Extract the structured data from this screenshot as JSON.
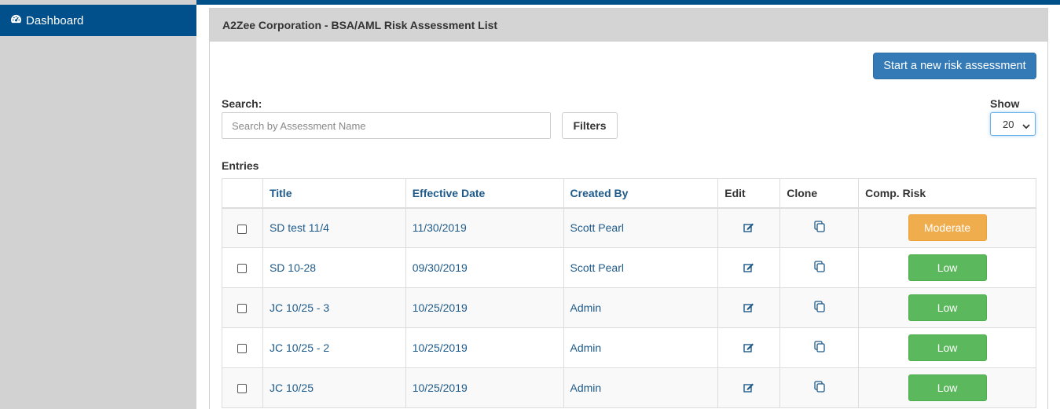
{
  "sidebar": {
    "items": [
      {
        "label": "Dashboard",
        "icon": "dashboard-icon"
      }
    ]
  },
  "panel": {
    "title": "A2Zee Corporation - BSA/AML Risk Assessment List",
    "new_button_label": "Start a new risk assessment"
  },
  "search": {
    "label": "Search:",
    "placeholder": "Search by Assessment Name",
    "value": "",
    "filters_label": "Filters"
  },
  "show": {
    "label": "Show",
    "selected": "20"
  },
  "entries_label": "Entries",
  "table": {
    "columns": [
      "",
      "Title",
      "Effective Date",
      "Created By",
      "Edit",
      "Clone",
      "Comp. Risk"
    ],
    "rows": [
      {
        "title": "SD test 11/4",
        "date": "11/30/2019",
        "created_by": "Scott Pearl",
        "risk": "Moderate",
        "risk_level": "moderate"
      },
      {
        "title": "SD 10-28",
        "date": "09/30/2019",
        "created_by": "Scott Pearl",
        "risk": "Low",
        "risk_level": "low"
      },
      {
        "title": "JC 10/25 - 3",
        "date": "10/25/2019",
        "created_by": "Admin",
        "risk": "Low",
        "risk_level": "low"
      },
      {
        "title": "JC 10/25 - 2",
        "date": "10/25/2019",
        "created_by": "Admin",
        "risk": "Low",
        "risk_level": "low"
      },
      {
        "title": "JC 10/25",
        "date": "10/25/2019",
        "created_by": "Admin",
        "risk": "Low",
        "risk_level": "low"
      }
    ]
  },
  "colors": {
    "brand": "#01508b",
    "primary_button": "#337ab7",
    "moderate": "#f0ad4e",
    "low": "#5cb85c",
    "link": "#1e5a8a"
  }
}
